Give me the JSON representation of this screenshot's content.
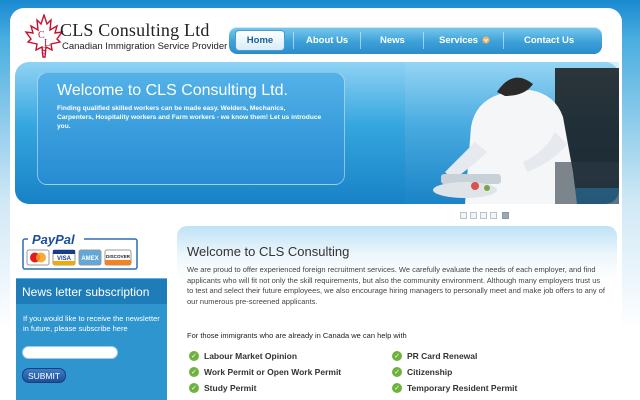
{
  "logo": {
    "title": "CLS Consulting Ltd",
    "subtitle": "Canadian Immigration Service Provider",
    "leaf_letters": [
      "C",
      "L",
      "S"
    ]
  },
  "nav": {
    "items": [
      {
        "label": "Home",
        "active": true
      },
      {
        "label": "About Us"
      },
      {
        "label": "News"
      },
      {
        "label": "Services"
      },
      {
        "label": "Contact Us"
      }
    ]
  },
  "hero": {
    "title": "Welcome to CLS Consulting Ltd.",
    "text": "Finding qualified skilled workers can be made easy. Welders, Mechanics, Carpenters, Hospitality workers and Farm workers - we know them! Let us introduce you."
  },
  "slider": {
    "slide_count": 5,
    "active_slide": 5
  },
  "paypal": {
    "brand": "PayPal",
    "cards": [
      "MasterCard",
      "VISA",
      "AMEX",
      "DISCOVER"
    ]
  },
  "newsletter": {
    "title": "News letter subscription",
    "text": "If you would like to receive the newsletter in future, please subscribe here",
    "email_placeholder": "",
    "submit_label": "SUBMIT"
  },
  "main": {
    "title": "Welcome to CLS Consulting",
    "paragraph": "We are proud to offer experienced foreign recruitment services. We carefully evaluate the needs of each employer, and find applicants who will fit not only the skill requirements, but also the community environment. Although many employers trust us to test and select their future employees, we also encourage hiring managers to personally meet and make job offers to any of our numerous pre-screened applicants.",
    "services_heading": "For those immigrants who are already in Canada we can help with",
    "services_left": [
      "Labour Market Opinion",
      "Work Permit or Open Work Permit",
      "Study Permit"
    ],
    "services_right": [
      "PR Card Renewal",
      "Citizenship",
      "Temporary Resident Permit"
    ]
  },
  "colors": {
    "brand_blue": "#1e7cb8",
    "check_green": "#6cb33f",
    "leaf_red": "#c8102e"
  }
}
